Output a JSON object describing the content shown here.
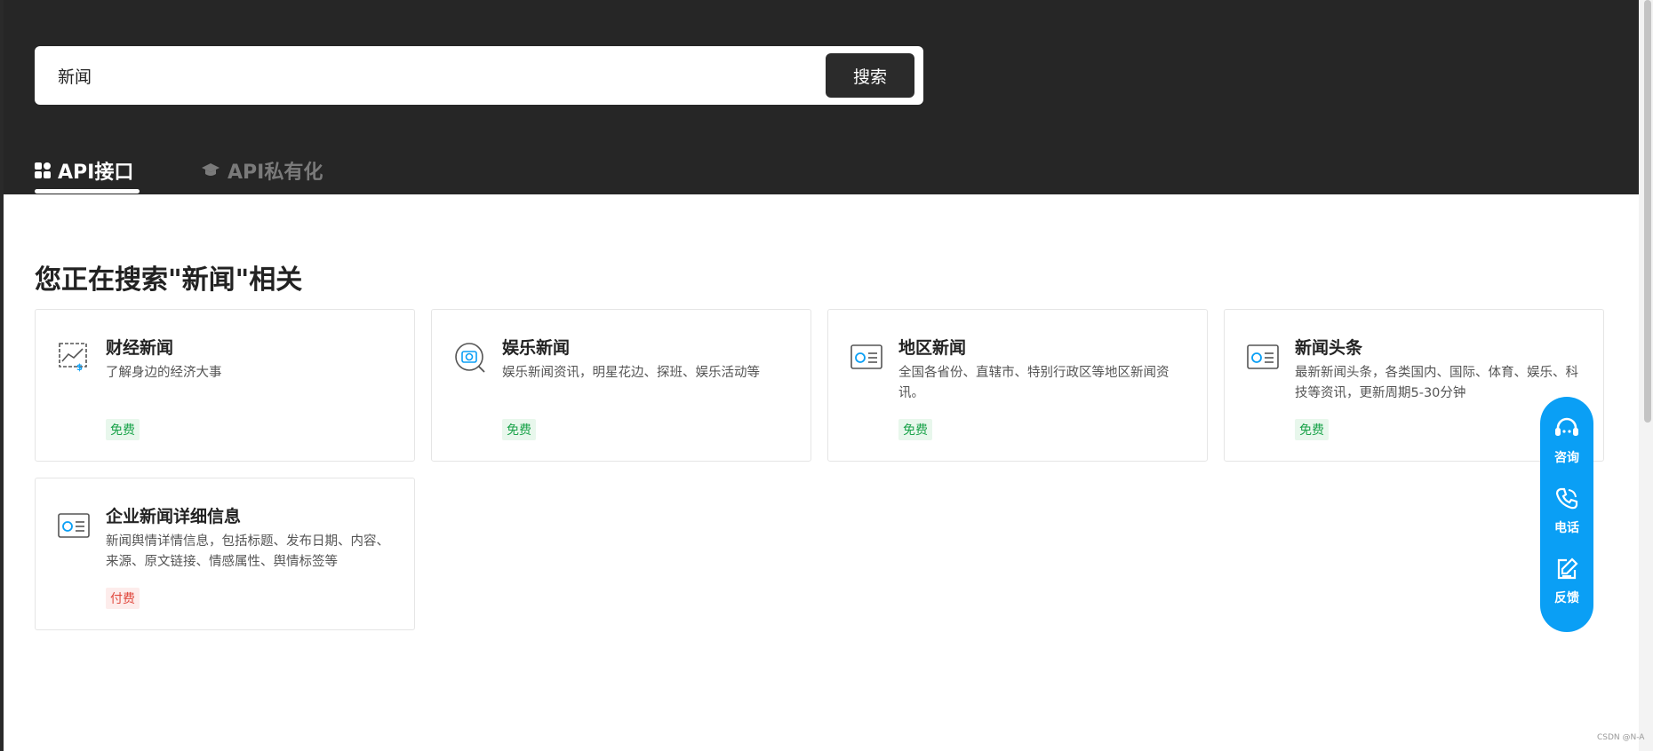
{
  "search": {
    "value": "新闻",
    "button_label": "搜索"
  },
  "tabs": [
    {
      "label": "API接口",
      "icon": "grid-icon",
      "active": true
    },
    {
      "label": "API私有化",
      "icon": "graduation-cap-icon",
      "active": false
    }
  ],
  "results": {
    "heading": "您正在搜索\"新闻\"相关",
    "cards": [
      {
        "title": "财经新闻",
        "desc": "了解身边的经济大事",
        "badge": "免费",
        "icon": "finance-chart-icon"
      },
      {
        "title": "娱乐新闻",
        "desc": "娱乐新闻资讯，明星花边、探班、娱乐活动等",
        "badge": "免费",
        "icon": "camera-search-icon"
      },
      {
        "title": "地区新闻",
        "desc": "全国各省份、直辖市、特别行政区等地区新闻资讯。",
        "badge": "免费",
        "icon": "news-card-icon"
      },
      {
        "title": "新闻头条",
        "desc": "最新新闻头条，各类国内、国际、体育、娱乐、科技等资讯，更新周期5-30分钟",
        "badge": "免费",
        "icon": "news-card-icon"
      },
      {
        "title": "企业新闻详细信息",
        "desc": "新闻舆情详情信息，包括标题、发布日期、内容、来源、原文链接、情感属性、舆情标签等",
        "badge": "付费",
        "icon": "news-card-icon"
      }
    ]
  },
  "float_bar": [
    {
      "label": "咨询",
      "icon": "headset-icon"
    },
    {
      "label": "电话",
      "icon": "phone-icon"
    },
    {
      "label": "反馈",
      "icon": "edit-icon"
    }
  ],
  "watermark": "CSDN @N-A",
  "colors": {
    "header_bg": "#262626",
    "accent": "#0a9ff5",
    "free": "#1aa34a",
    "paid": "#e0483d"
  }
}
